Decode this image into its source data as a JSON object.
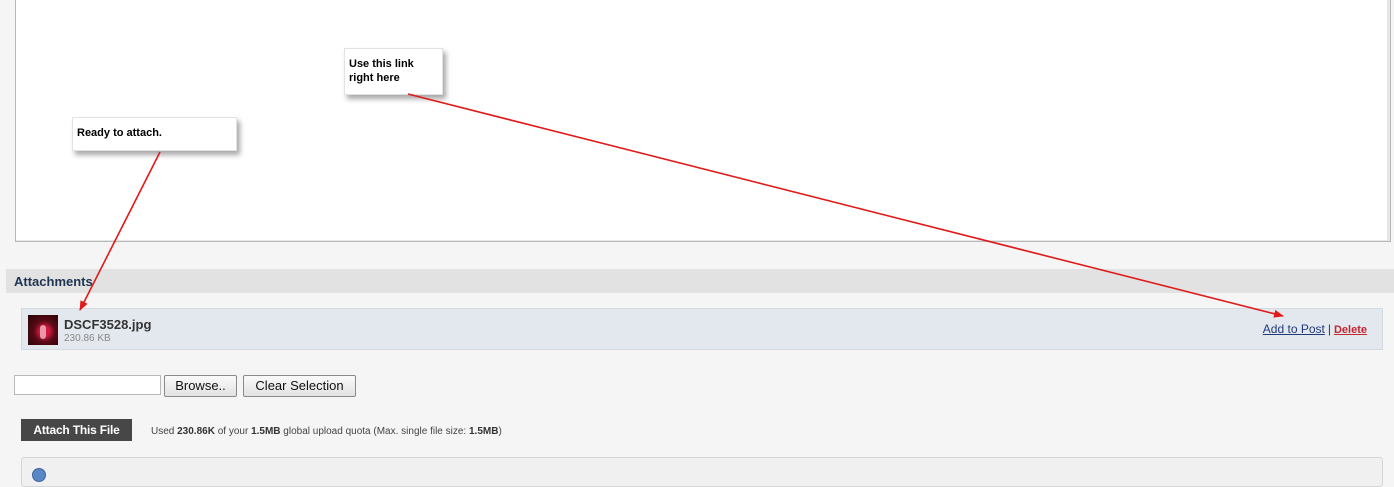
{
  "callouts": {
    "ready": "Ready to attach.",
    "link_line1": "Use this link",
    "link_line2": "right here"
  },
  "attachments": {
    "title": "Attachments",
    "item": {
      "file_name": "DSCF3528.jpg",
      "file_size": "230.86 KB",
      "add_to_post": "Add to Post",
      "separator": "|",
      "delete": "Delete"
    }
  },
  "upload": {
    "file_value": "",
    "browse_label": "Browse..",
    "clear_label": "Clear Selection",
    "attach_label": "Attach This File",
    "quota_prefix": "Used ",
    "quota_used": "230.86K",
    "quota_mid": " of your ",
    "quota_total": "1.5MB",
    "quota_suffix1": " global upload quota (Max. single file size: ",
    "quota_max": "1.5MB",
    "quota_suffix2": ")"
  },
  "colors": {
    "arrow": "#e01a1a",
    "header_text": "#1f3552",
    "delete": "#c1272d"
  },
  "icons": {
    "thumbnail": "image-thumbnail-icon",
    "info": "info-icon"
  }
}
